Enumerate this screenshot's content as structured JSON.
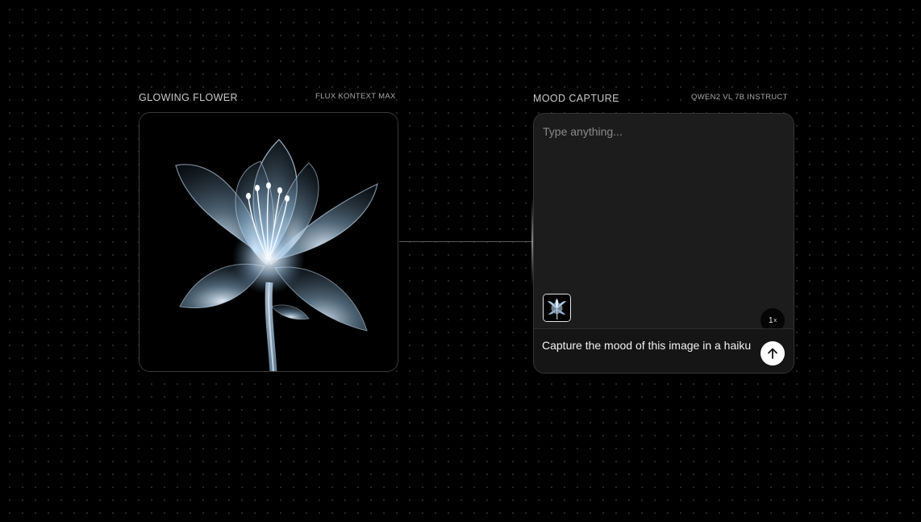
{
  "image_node": {
    "title": "GLOWING FLOWER",
    "model": "FLUX KONTEXT MAX"
  },
  "chat_node": {
    "title": "MOOD CAPTURE",
    "model": "QWEN2 VL 7B INSTRUCT",
    "input_placeholder": "Type anything...",
    "multiplier": "1",
    "multiplier_suffix": "x",
    "prompt": "Capture the mood of this image in a haiku"
  },
  "icons": {
    "send": "arrow-up-icon",
    "thumbnail": "flower-thumbnail"
  },
  "colors": {
    "background": "#000000",
    "node_bg": "#1c1c1c",
    "footer_bg": "#151515",
    "flower_glow": "#9fc3df"
  }
}
